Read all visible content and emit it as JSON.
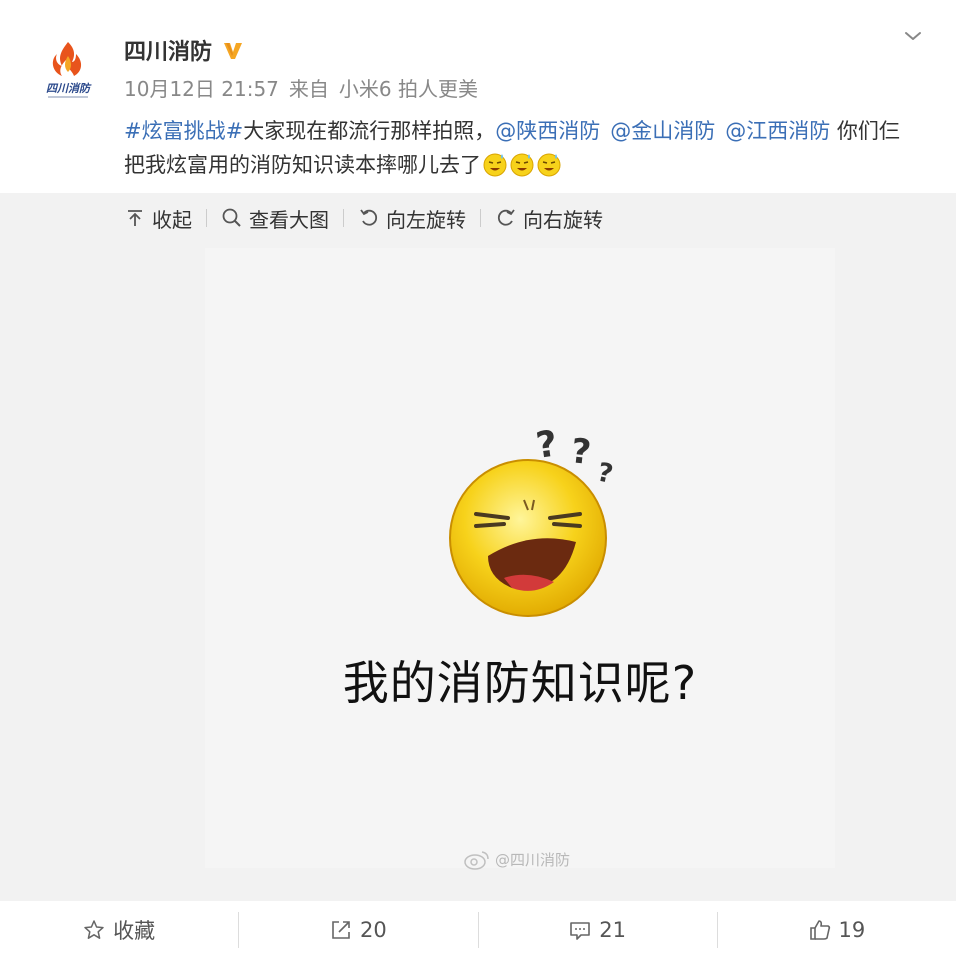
{
  "account": {
    "name": "四川消防",
    "logo_text": "四川消防",
    "verified": true
  },
  "meta": {
    "time": "10月12日 21:57",
    "source_prefix": "来自",
    "source": "小米6 拍人更美"
  },
  "post": {
    "hashtag": "#炫富挑战#",
    "text1": "大家现在都流行那样拍照，",
    "mention1": "@陕西消防",
    "mention2": "@金山消防",
    "mention3": "@江西消防",
    "text2": "你们仨把我炫富用的消防知识读本摔哪儿去了"
  },
  "toolbar": {
    "collapse": "收起",
    "view_large": "查看大图",
    "rotate_left": "向左旋转",
    "rotate_right": "向右旋转"
  },
  "image": {
    "caption": "我的消防知识呢?",
    "watermark": "@四川消防"
  },
  "actions": {
    "favorite": "收藏",
    "repost_count": "20",
    "comment_count": "21",
    "like_count": "19"
  },
  "colors": {
    "link": "#3b6fb6",
    "verified_badge": "#f5a623",
    "media_bg": "#f2f2f2",
    "emoji_yellow": "#f7d21b"
  }
}
